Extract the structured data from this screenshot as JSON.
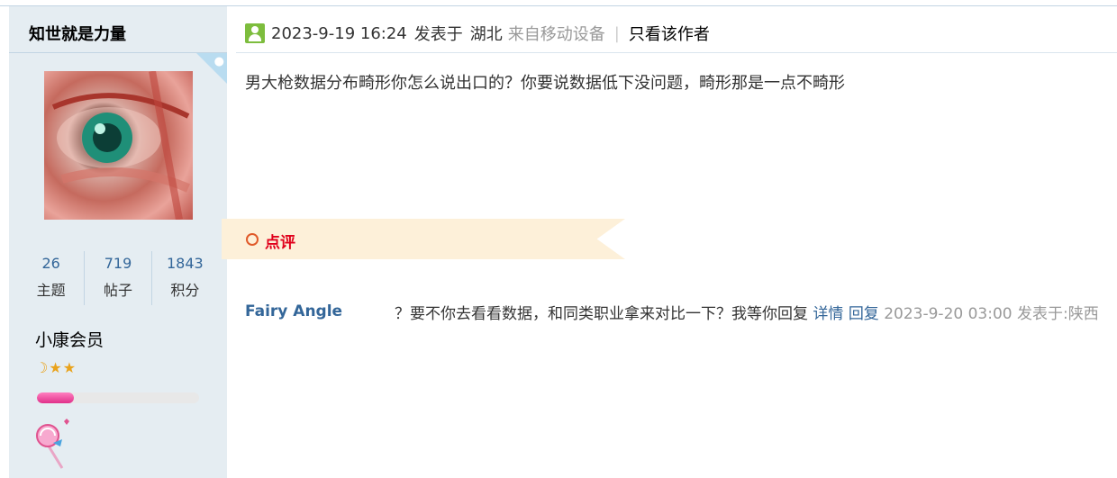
{
  "user": {
    "name": "知世就是力量",
    "stats": [
      {
        "value": "26",
        "label": "主题"
      },
      {
        "value": "719",
        "label": "帖子"
      },
      {
        "value": "1843",
        "label": "积分"
      }
    ],
    "rank": "小康会员",
    "level_icons": [
      "moon-icon",
      "star-icon",
      "star-icon"
    ],
    "level_progress": 0.23,
    "badge_icon": "lollipop-icon"
  },
  "post": {
    "date": "2023-9-19 16:24",
    "posted_in": "发表于",
    "location": "湖北",
    "device": "来自移动设备",
    "separator": "|",
    "only_author": "只看该作者",
    "content": "男大枪数据分布畸形你怎么说出口的？你要说数据低下没问题，畸形那是一点不畸形"
  },
  "comments": {
    "tab_label": "点评",
    "items": [
      {
        "user": "Fairy Angle",
        "text": "？要不你去看看数据，和同类职业拿来对比一下？我等你回复",
        "details": "详情",
        "reply": "回复",
        "meta": "2023-9-20 03:00 发表于:陕西"
      }
    ]
  },
  "colors": {
    "link": "#336699",
    "side_bg": "#e5edf2",
    "accent_red": "#e0001b"
  }
}
